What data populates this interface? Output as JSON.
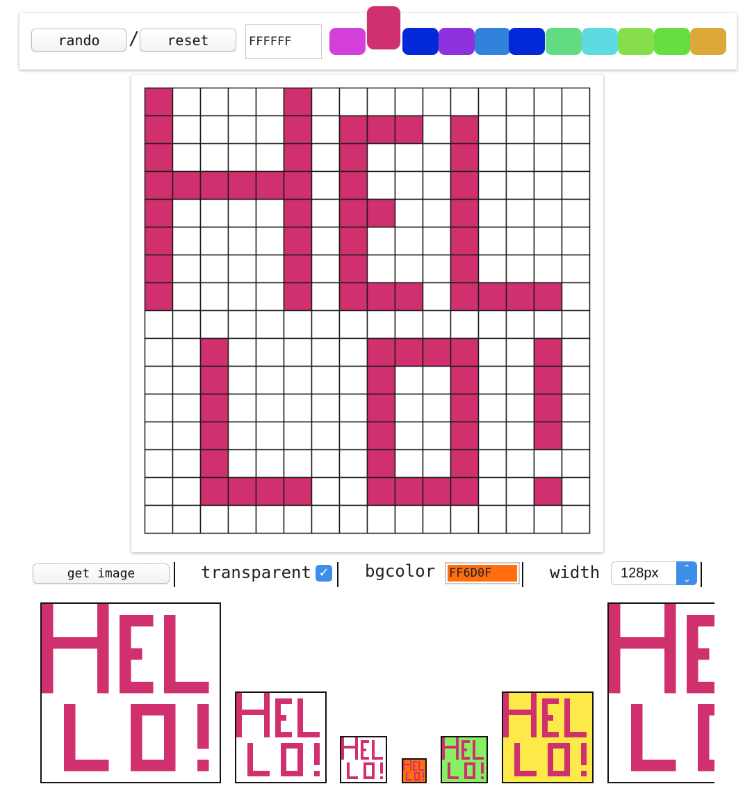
{
  "toolbar": {
    "rando_label": "rando",
    "separator": "/",
    "reset_label": "reset",
    "hex_value": "FFFFFF",
    "swatches": [
      "#D43ED9",
      "#D1306E",
      "#0328D8",
      "#8E32DE",
      "#3282DB",
      "#0328D8",
      "#63DB83",
      "#5EDBE1",
      "#85DE4A",
      "#65DE42",
      "#DCA83A"
    ],
    "selected_swatch_index": 1
  },
  "canvas": {
    "rows": 16,
    "cols": 16,
    "paint_color": "#D1306E",
    "pixels": [
      "1000010000000000",
      "1000010111010000",
      "1000010100010000",
      "1111110100010000",
      "1000010110010000",
      "1000010100010000",
      "1000010100010000",
      "1000010111011110",
      "0000000000000000",
      "0010000011110010",
      "0010000010010010",
      "0010000010010010",
      "0010000010010010",
      "0010000010010000",
      "0011110011110010",
      "0000000000000000"
    ]
  },
  "controls": {
    "get_image_label": "get image",
    "transparent_label": "transparent",
    "transparent_checked": true,
    "checkmark": "✓",
    "bgcolor_label": "bgcolor",
    "bgcolor_value": "FF6D0F",
    "width_label": "width",
    "width_value": "128px"
  },
  "previews": [
    {
      "background": "#FFFFFF"
    },
    {
      "background": "#FFFFFF"
    },
    {
      "background": "#FFFFFF"
    },
    {
      "background": "#FF6D0F"
    },
    {
      "background": "#85F061"
    },
    {
      "background": "#FDE947"
    },
    {
      "background": "#FFFFFF"
    }
  ]
}
